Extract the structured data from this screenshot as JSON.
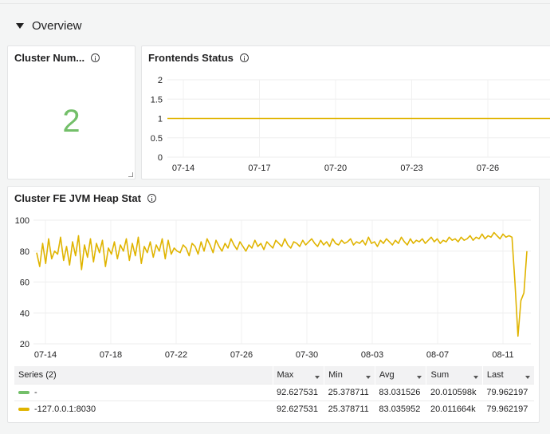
{
  "row": {
    "title": "Overview"
  },
  "stat_panel": {
    "title": "Cluster Num...",
    "value": "2",
    "value_color": "#73bf69"
  },
  "frontends_panel": {
    "title": "Frontends Status",
    "chart_data": {
      "type": "line",
      "y_ticks": [
        "2",
        "1.5",
        "1",
        "0.5",
        "0"
      ],
      "x_ticks": [
        "07-14",
        "07-17",
        "07-20",
        "07-23",
        "07-26"
      ],
      "ylim": [
        0,
        2
      ],
      "series": [
        {
          "values_constant": 1,
          "color": "#e0b400"
        }
      ],
      "grid": true
    }
  },
  "heap_panel": {
    "title": "Cluster FE JVM Heap Stat",
    "chart_data": {
      "type": "line",
      "y_ticks": [
        "100",
        "80",
        "60",
        "40",
        "20"
      ],
      "x_ticks": [
        "07-14",
        "07-18",
        "07-22",
        "07-26",
        "07-30",
        "08-03",
        "08-07",
        "08-11"
      ],
      "ylim": [
        20,
        100
      ],
      "grid": true,
      "series": [
        {
          "name": "-127.0.0.1:8030",
          "color": "#e0b400",
          "values": [
            79,
            70,
            85,
            72,
            88,
            75,
            80,
            78,
            89,
            74,
            83,
            71,
            86,
            77,
            90,
            68,
            84,
            76,
            88,
            73,
            85,
            79,
            87,
            70,
            82,
            78,
            86,
            75,
            84,
            80,
            88,
            74,
            85,
            77,
            89,
            72,
            83,
            79,
            86,
            76,
            84,
            80,
            88,
            75,
            87,
            78,
            82,
            80,
            79,
            84,
            82,
            77,
            85,
            83,
            78,
            86,
            80,
            88,
            84,
            79,
            87,
            83,
            80,
            85,
            82,
            88,
            84,
            81,
            86,
            83,
            80,
            84,
            82,
            87,
            83,
            85,
            81,
            86,
            84,
            82,
            87,
            85,
            83,
            88,
            84,
            82,
            86,
            85,
            83,
            87,
            84,
            86,
            88,
            85,
            83,
            87,
            84,
            86,
            83,
            88,
            85,
            84,
            87,
            85,
            86,
            88,
            84,
            86,
            85,
            87,
            84,
            89,
            85,
            86,
            83,
            87,
            85,
            88,
            86,
            84,
            87,
            85,
            89,
            86,
            84,
            88,
            85,
            87,
            86,
            88,
            85,
            87,
            89,
            86,
            88,
            85,
            87,
            86,
            89,
            87,
            88,
            86,
            89,
            87,
            88,
            90,
            87,
            89,
            88,
            91,
            88,
            90,
            89,
            92,
            90,
            88,
            91,
            89,
            90,
            89,
            60,
            25,
            48,
            53,
            80
          ]
        }
      ]
    },
    "legend": {
      "headers": {
        "series": "Series (2)",
        "max": "Max",
        "min": "Min",
        "avg": "Avg",
        "sum": "Sum",
        "last": "Last"
      },
      "rows": [
        {
          "name": "-",
          "color": "#73bf69",
          "max": "92.627531",
          "min": "25.378711",
          "avg": "83.031526",
          "sum": "20.010598k",
          "last": "79.962197"
        },
        {
          "name": "-127.0.0.1:8030",
          "color": "#e0b400",
          "max": "92.627531",
          "min": "25.378711",
          "avg": "83.035952",
          "sum": "20.011664k",
          "last": "79.962197"
        }
      ]
    }
  }
}
